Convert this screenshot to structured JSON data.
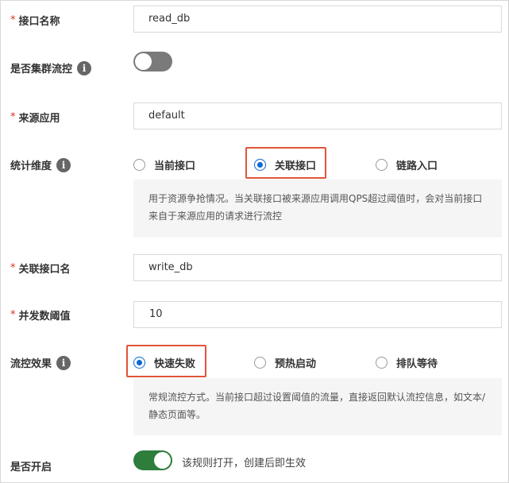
{
  "form": {
    "api_name": {
      "label": "接口名称",
      "required": "*",
      "value": "read_db"
    },
    "cluster_flow": {
      "label": "是否集群流控",
      "info": "i",
      "state": "off"
    },
    "source_app": {
      "label": "来源应用",
      "required": "*",
      "value": "default"
    },
    "stat_dimension": {
      "label": "统计维度",
      "info": "i",
      "options": [
        "当前接口",
        "关联接口",
        "链路入口"
      ],
      "selected": "关联接口",
      "description": "用于资源争抢情况。当关联接口被来源应用调用QPS超过阈值时，会对当前接口来自于来源应用的请求进行流控"
    },
    "related_api": {
      "label": "关联接口名",
      "required": "*",
      "value": "write_db"
    },
    "concurrency_threshold": {
      "label": "并发数阈值",
      "required": "*",
      "value": "10"
    },
    "flow_effect": {
      "label": "流控效果",
      "info": "i",
      "options": [
        "快速失败",
        "预热启动",
        "排队等待"
      ],
      "selected": "快速失败",
      "description": "常规流控方式。当前接口超过设置阈值的流量，直接返回默认流控信息，如文本/静态页面等。"
    },
    "enabled": {
      "label": "是否开启",
      "state": "on",
      "hint": "该规则打开，创建后即生效"
    }
  },
  "colors": {
    "accent": "#0a68d6",
    "required": "#e0301e",
    "highlight": "#e0553a",
    "toggle_on": "#2e7d3b",
    "toggle_off": "#7a7a7a"
  }
}
